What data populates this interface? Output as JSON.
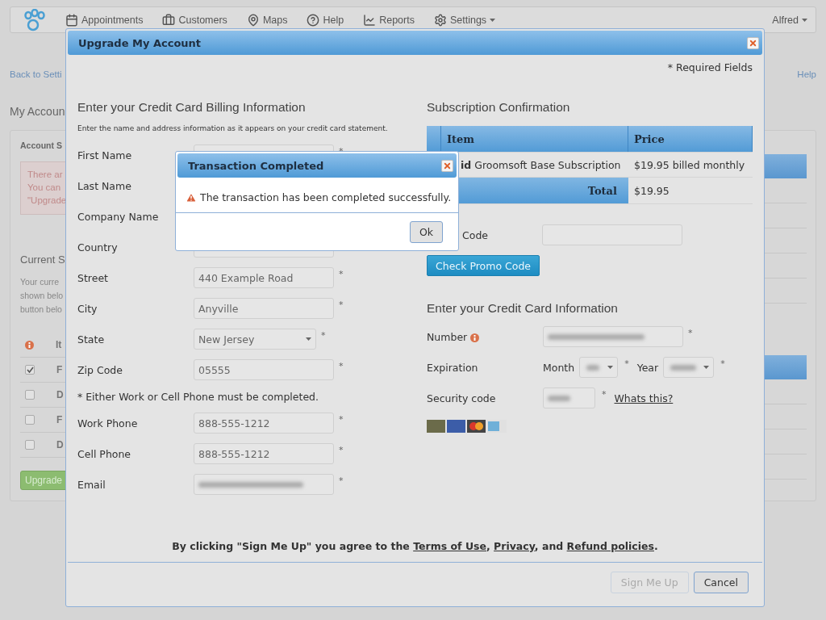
{
  "navbar": {
    "items": [
      {
        "label": "Appointments",
        "dropdown": false
      },
      {
        "label": "Customers",
        "dropdown": false
      },
      {
        "label": "Maps",
        "dropdown": false
      },
      {
        "label": "Help",
        "dropdown": false
      },
      {
        "label": "Reports",
        "dropdown": false
      },
      {
        "label": "Settings",
        "dropdown": true
      }
    ],
    "user": {
      "label": "Alfred",
      "dropdown": true
    }
  },
  "page": {
    "back_link": "Back to Setti",
    "help_link": "Help",
    "title": "My Accoun",
    "card": {
      "heading": "Account S",
      "alert_lines": [
        "There ar",
        "You can",
        "\"Upgrade"
      ],
      "section_title": "Current S",
      "description_lines": [
        "Your curre",
        "shown belo",
        "button belo"
      ],
      "table": {
        "column_2": "It",
        "rows": [
          {
            "checked": true,
            "label": "F"
          },
          {
            "checked": false,
            "label": "D"
          },
          {
            "checked": false,
            "label": "F"
          },
          {
            "checked": false,
            "label": "D"
          }
        ]
      },
      "upgrade_button": "Upgrade"
    }
  },
  "dialog": {
    "title": "Upgrade My Account",
    "required_note": "* Required Fields",
    "billing": {
      "heading": "Enter your Credit Card Billing Information",
      "note": "Enter the name and address information as it appears on your credit card statement.",
      "fields": [
        {
          "kind": "text",
          "label": "First Name",
          "mark": "*"
        },
        {
          "kind": "text",
          "label": "Last Name"
        },
        {
          "kind": "text",
          "label": "Company Name"
        },
        {
          "kind": "text",
          "label": "Country"
        },
        {
          "kind": "text",
          "label": "Street",
          "value": "440 Example Road",
          "mark": "*"
        },
        {
          "kind": "text",
          "label": "City",
          "value": "Anyville",
          "mark": "*"
        },
        {
          "kind": "select",
          "label": "State",
          "value": "New Jersey",
          "mark": "*"
        },
        {
          "kind": "text",
          "label": "Zip Code",
          "value": "05555",
          "mark": "*"
        },
        {
          "kind": "note",
          "text": "* Either Work or Cell Phone must be completed."
        },
        {
          "kind": "text",
          "label": "Work Phone",
          "value": "888-555-1212",
          "mark": "*"
        },
        {
          "kind": "text",
          "label": "Cell Phone",
          "value": "888-555-1212",
          "mark": "*"
        },
        {
          "kind": "blurred",
          "label": "Email",
          "mark": "*"
        }
      ]
    },
    "subscription": {
      "heading": "Subscription Confirmation",
      "columns": [
        "Item",
        "Price"
      ],
      "rows": [
        {
          "item": "**id** Groomsoft Base Subscription",
          "price": "$19.95 billed monthly"
        }
      ],
      "total_label": "Total",
      "total": "$19.95",
      "promo_label": "Code",
      "promo_button": "Check Promo Code"
    },
    "card_info": {
      "heading": "Enter your Credit Card Information",
      "number_label": "Number",
      "number_mark": "*",
      "expiration_label": "Expiration",
      "month_label": "Month",
      "month_mark": "*",
      "year_label": "Year",
      "year_mark": "*",
      "security_label": "Security code",
      "security_mark": "*",
      "whats_this": "Whats this?"
    },
    "agreement": [
      {
        "kind": "text",
        "text": "By clicking \"Sign Me Up\" you agree to the "
      },
      {
        "kind": "link",
        "text": "Terms of Use"
      },
      {
        "kind": "text",
        "text": ", "
      },
      {
        "kind": "link",
        "text": "Privacy"
      },
      {
        "kind": "text",
        "text": ", and "
      },
      {
        "kind": "link",
        "text": "Refund policies"
      },
      {
        "kind": "text",
        "text": "."
      }
    ],
    "buttons": [
      {
        "label": "Sign Me Up",
        "disabled": true
      },
      {
        "label": "Cancel",
        "disabled": false
      }
    ]
  },
  "alert": {
    "title": "Transaction Completed",
    "message": "The transaction has been completed successfully.",
    "button": "Ok"
  }
}
